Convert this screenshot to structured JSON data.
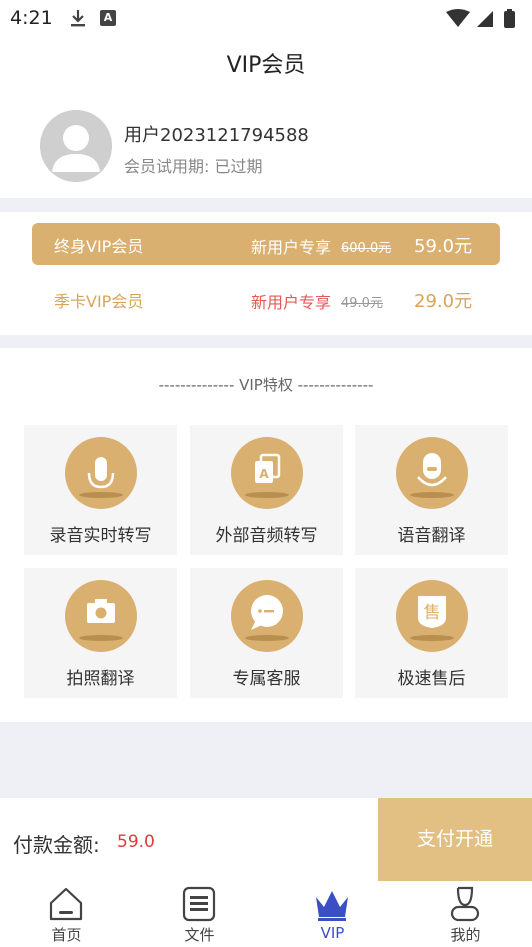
{
  "status_bar": {
    "time": "4:21",
    "notif_a": "A"
  },
  "header": {
    "title": "VIP会员"
  },
  "profile": {
    "username": "用户2023121794588",
    "membership_status": "会员试用期: 已过期"
  },
  "plans": [
    {
      "name": "终身VIP会员",
      "promo": "新用户专享",
      "original_price": "600.0元",
      "price": "59.0元",
      "selected": true
    },
    {
      "name": "季卡VIP会员",
      "promo": "新用户专享",
      "original_price": "49.0元",
      "price": "29.0元",
      "selected": false
    }
  ],
  "features": {
    "title": "-------------- VIP特权 --------------",
    "items": [
      {
        "label": "录音实时转写",
        "icon": "microphone-icon"
      },
      {
        "label": "外部音频转写",
        "icon": "audio-file-icon"
      },
      {
        "label": "语音翻译",
        "icon": "voice-translate-icon"
      },
      {
        "label": "拍照翻译",
        "icon": "camera-icon"
      },
      {
        "label": "专属客服",
        "icon": "chat-icon"
      },
      {
        "label": "极速售后",
        "icon": "after-sales-icon"
      }
    ],
    "after_sales_glyph": "售",
    "audio_file_glyph": "A"
  },
  "payment": {
    "label": "付款金额:",
    "amount": "59.0",
    "button": "支付开通"
  },
  "tabs": [
    {
      "label": "首页",
      "icon": "home-icon"
    },
    {
      "label": "文件",
      "icon": "file-icon"
    },
    {
      "label": "VIP",
      "icon": "crown-icon",
      "active": true
    },
    {
      "label": "我的",
      "icon": "profile-icon"
    }
  ],
  "colors": {
    "gold": "#d9b06f",
    "pay_button": "#e2c084",
    "accent_red": "#e03a3a",
    "tab_active": "#3a4fc4"
  }
}
